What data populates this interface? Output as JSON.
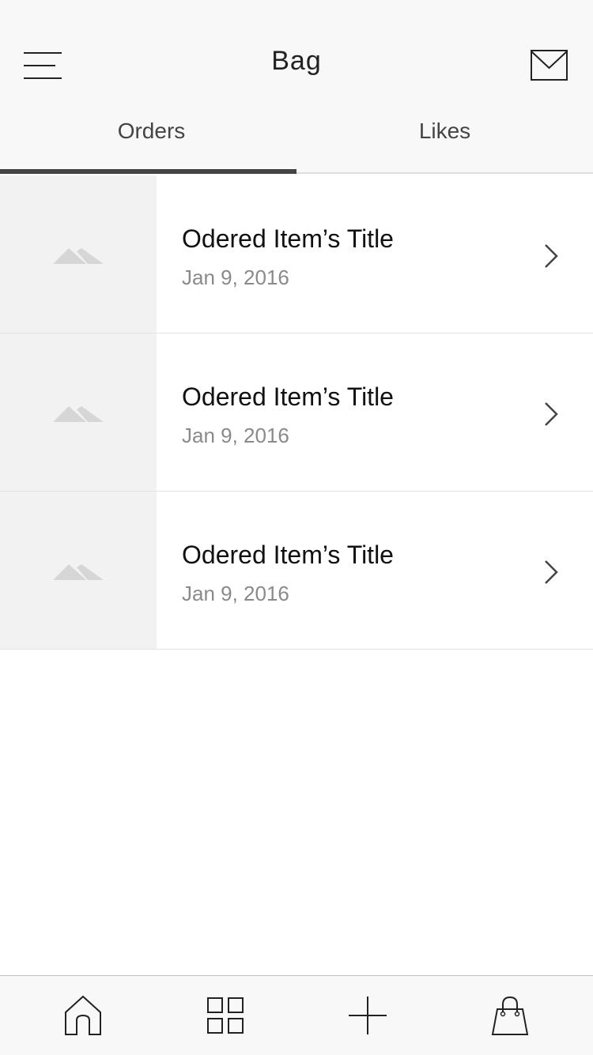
{
  "header": {
    "title": "Bag",
    "menu_icon": "hamburger-menu-icon",
    "mail_icon": "envelope-icon"
  },
  "tabs": [
    {
      "label": "Orders",
      "active": true
    },
    {
      "label": "Likes",
      "active": false
    }
  ],
  "orders": [
    {
      "title": "Odered Item’s Title",
      "date": "Jan 9, 2016",
      "thumbnail_icon": "image-placeholder-icon"
    },
    {
      "title": "Odered Item’s Title",
      "date": "Jan 9, 2016",
      "thumbnail_icon": "image-placeholder-icon"
    },
    {
      "title": "Odered Item’s Title",
      "date": "Jan 9, 2016",
      "thumbnail_icon": "image-placeholder-icon"
    }
  ],
  "tab_bar": {
    "items": [
      {
        "icon": "home-icon"
      },
      {
        "icon": "grid-icon"
      },
      {
        "icon": "plus-icon"
      },
      {
        "icon": "shopping-bag-icon"
      }
    ]
  },
  "colors": {
    "header_bg": "#f8f8f8",
    "text": "#222222",
    "secondary_text": "#8a8a8a",
    "thumb_bg": "#f2f2f2",
    "tab_indicator": "#444444"
  }
}
